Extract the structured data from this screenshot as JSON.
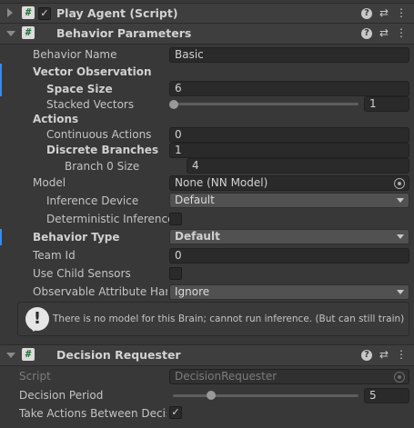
{
  "play_agent": {
    "title": "Play Agent (Script)",
    "enabled": true
  },
  "behavior_parameters": {
    "title": "Behavior Parameters",
    "fields": {
      "behavior_name_label": "Behavior Name",
      "behavior_name_value": "Basic",
      "vector_observation_label": "Vector Observation",
      "space_size_label": "Space Size",
      "space_size_value": "6",
      "stacked_vectors_label": "Stacked Vectors",
      "stacked_vectors_value": "1",
      "stacked_vectors_slider": 0,
      "actions_label": "Actions",
      "continuous_actions_label": "Continuous Actions",
      "continuous_actions_value": "0",
      "discrete_branches_label": "Discrete Branches",
      "discrete_branches_value": "1",
      "branch0_label": "Branch 0 Size",
      "branch0_value": "4",
      "model_label": "Model",
      "model_value": "None (NN Model)",
      "inference_device_label": "Inference Device",
      "inference_device_value": "Default",
      "deterministic_label": "Deterministic Inference",
      "behavior_type_label": "Behavior Type",
      "behavior_type_value": "Default",
      "team_id_label": "Team Id",
      "team_id_value": "0",
      "child_sensors_label": "Use Child Sensors",
      "observable_label": "Observable Attribute Hand",
      "observable_value": "Ignore"
    },
    "help_message": "There is no model for this Brain; cannot run inference. (But can still train)"
  },
  "decision_requester": {
    "title": "Decision Requester",
    "script_label": "Script",
    "script_value": "DecisionRequester",
    "decision_period_label": "Decision Period",
    "decision_period_value": "5",
    "decision_period_slider": 0.2,
    "take_actions_label": "Take Actions Between Decis",
    "take_actions_checked": true
  },
  "icons": {
    "help": "help-icon",
    "preset": "preset-sliders-icon",
    "menu": "kebab-menu-icon",
    "script": "csharp-script-icon",
    "warning": "warning-icon"
  },
  "glyphs": {
    "hash": "#",
    "check": "✓",
    "help": "?",
    "preset": "⇄",
    "menu": "⋮",
    "warn": "!"
  }
}
